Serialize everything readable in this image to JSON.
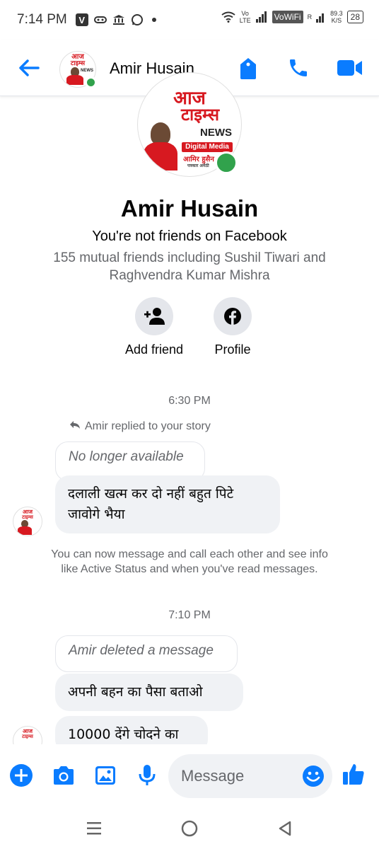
{
  "status_bar": {
    "time": "7:14 PM",
    "network_vo": "Vo",
    "network_lte": "LTE",
    "vowifi": "VoWiFi",
    "r_label": "R",
    "speed_value": "89.3",
    "speed_unit": "K/S",
    "battery": "28"
  },
  "header": {
    "contact_name": "Amir Husain"
  },
  "logo": {
    "top_text": "आज",
    "brand_text": "टाइम्स",
    "news_text": "NEWS",
    "band_text": "Digital Media",
    "sub_text": "आमिर हुसैन",
    "tagline": "पत्रकार अमेठी"
  },
  "profile": {
    "name": "Amir Husain",
    "friend_status": "You're not friends on Facebook",
    "mutual_friends": "155 mutual friends including Sushil Tiwari and Raghvendra Kumar Mishra",
    "actions": [
      {
        "label": "Add friend",
        "icon": "add-friend-icon"
      },
      {
        "label": "Profile",
        "icon": "facebook-icon"
      }
    ]
  },
  "conversation": {
    "time_1": "6:30 PM",
    "reply_note": "Amir replied to your story",
    "quoted_story": "No longer available",
    "message_1": "दलाली खत्म कर दो नहीं बहुत पिटे जावोगे भैया",
    "info_note": "You can now message and call each other and see info like Active Status and when you've read messages.",
    "time_2": "7:10 PM",
    "deleted_note": "Amir deleted a message",
    "message_2": "अपनी बहन का पैसा बताओ",
    "message_3": "10000 देंगे चोदने का"
  },
  "composer": {
    "placeholder": "Message"
  },
  "colors": {
    "accent": "#0a7cff",
    "bubble": "#f0f2f5",
    "online": "#31a24c",
    "brand_red": "#d71920"
  }
}
